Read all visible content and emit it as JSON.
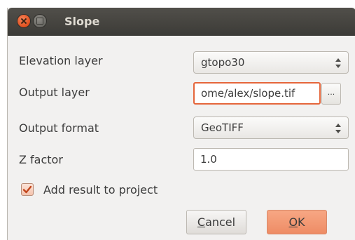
{
  "window": {
    "title": "Slope"
  },
  "form": {
    "elevation_layer": {
      "label": "Elevation layer",
      "value": "gtopo30"
    },
    "output_layer": {
      "label": "Output layer",
      "value": "ome/alex/slope.tif",
      "browse_label": "..."
    },
    "output_format": {
      "label": "Output format",
      "value": "GeoTIFF"
    },
    "z_factor": {
      "label": "Z factor",
      "value": "1.0"
    },
    "add_result": {
      "label": "Add result to project",
      "checked": true
    }
  },
  "buttons": {
    "cancel_mnemonic": "C",
    "cancel_rest": "ancel",
    "ok_mnemonic": "O",
    "ok_rest": "K"
  },
  "colors": {
    "accent": "#e5663b",
    "titlebar": "#3c3b37",
    "close_button": "#e04f1d"
  }
}
